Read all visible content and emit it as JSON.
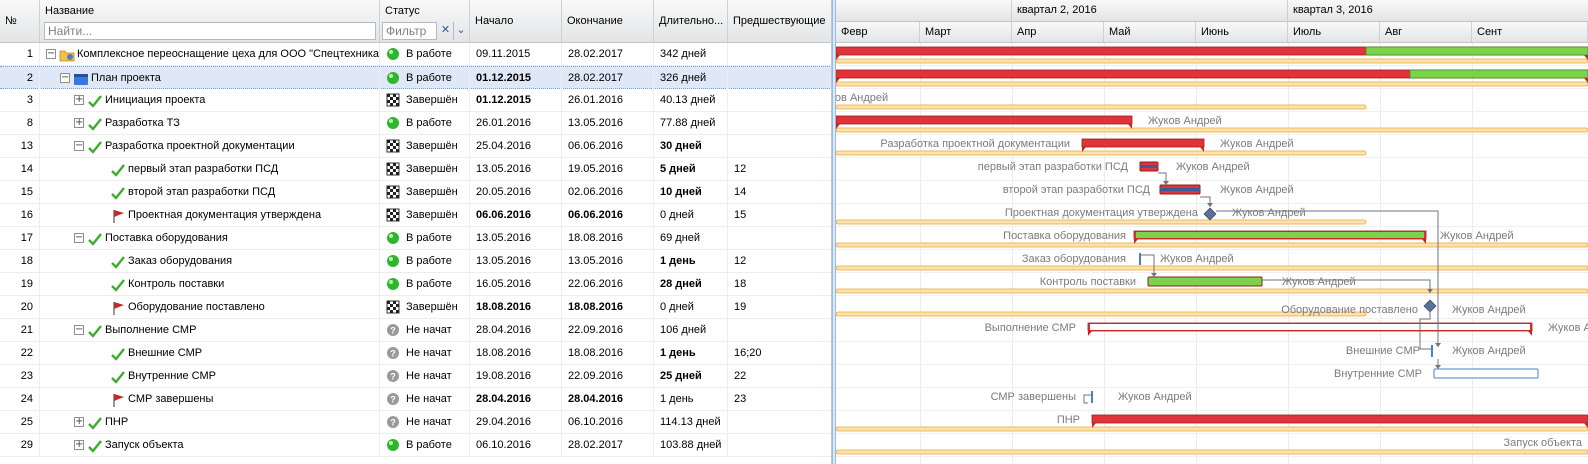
{
  "columns": {
    "num": "№",
    "name": "Название",
    "status": "Статус",
    "start": "Начало",
    "end": "Окончание",
    "duration": "Длительно...",
    "pred": "Предшествующие"
  },
  "filter": {
    "name_placeholder": "Найти...",
    "status_placeholder": "Фильтр"
  },
  "rows": [
    {
      "num": "1",
      "name": "Комплексное переоснащение цеха для ООО \"Спецтехника\"",
      "status": "В работе",
      "start": "09.11.2015",
      "end": "28.02.2017",
      "duration": "342 дней",
      "pred": ""
    },
    {
      "num": "2",
      "name": "План проекта",
      "status": "В работе",
      "start": "01.12.2015",
      "end": "28.02.2017",
      "duration": "326 дней",
      "pred": ""
    },
    {
      "num": "3",
      "name": "Инициация проекта",
      "status": "Завершён",
      "start": "01.12.2015",
      "end": "26.01.2016",
      "duration": "40.13 дней",
      "pred": ""
    },
    {
      "num": "8",
      "name": "Разработка ТЗ",
      "status": "В работе",
      "start": "26.01.2016",
      "end": "13.05.2016",
      "duration": "77.88 дней",
      "pred": ""
    },
    {
      "num": "13",
      "name": "Разработка проектной документации",
      "status": "Завершён",
      "start": "25.04.2016",
      "end": "06.06.2016",
      "duration": "30 дней",
      "pred": ""
    },
    {
      "num": "14",
      "name": "первый этап разработки ПСД",
      "status": "Завершён",
      "start": "13.05.2016",
      "end": "19.05.2016",
      "duration": "5 дней",
      "pred": "12"
    },
    {
      "num": "15",
      "name": "второй этап разработки ПСД",
      "status": "Завершён",
      "start": "20.05.2016",
      "end": "02.06.2016",
      "duration": "10 дней",
      "pred": "14"
    },
    {
      "num": "16",
      "name": "Проектная документация утверждена",
      "status": "Завершён",
      "start": "06.06.2016",
      "end": "06.06.2016",
      "duration": "0 дней",
      "pred": "15"
    },
    {
      "num": "17",
      "name": "Поставка оборудования",
      "status": "В работе",
      "start": "13.05.2016",
      "end": "18.08.2016",
      "duration": "69 дней",
      "pred": ""
    },
    {
      "num": "18",
      "name": "Заказ оборудования",
      "status": "В работе",
      "start": "13.05.2016",
      "end": "13.05.2016",
      "duration": "1 день",
      "pred": "12"
    },
    {
      "num": "19",
      "name": "Контроль поставки",
      "status": "В работе",
      "start": "16.05.2016",
      "end": "22.06.2016",
      "duration": "28 дней",
      "pred": "18"
    },
    {
      "num": "20",
      "name": "Оборудование поставлено",
      "status": "Завершён",
      "start": "18.08.2016",
      "end": "18.08.2016",
      "duration": "0 дней",
      "pred": "19"
    },
    {
      "num": "21",
      "name": "Выполнение СМР",
      "status": "Не начат",
      "start": "28.04.2016",
      "end": "22.09.2016",
      "duration": "106 дней",
      "pred": ""
    },
    {
      "num": "22",
      "name": "Внешние СМР",
      "status": "Не начат",
      "start": "18.08.2016",
      "end": "18.08.2016",
      "duration": "1 день",
      "pred": "16;20"
    },
    {
      "num": "23",
      "name": "Внутренние СМР",
      "status": "Не начат",
      "start": "19.08.2016",
      "end": "22.09.2016",
      "duration": "25 дней",
      "pred": "22"
    },
    {
      "num": "24",
      "name": "СМР завершены",
      "status": "Не начат",
      "start": "28.04.2016",
      "end": "28.04.2016",
      "duration": "1 день",
      "pred": "23"
    },
    {
      "num": "25",
      "name": "ПНР",
      "status": "Не начат",
      "start": "29.04.2016",
      "end": "06.10.2016",
      "duration": "114.13 дней",
      "pred": ""
    },
    {
      "num": "29",
      "name": "Запуск объекта",
      "status": "В работе",
      "start": "06.10.2016",
      "end": "28.02.2017",
      "duration": "103.88 дней",
      "pred": ""
    }
  ],
  "timeline": {
    "quarters": [
      "квартал 2, 2016",
      "квартал 3, 2016"
    ],
    "months": [
      "Февр",
      "Март",
      "Апр",
      "Май",
      "Июнь",
      "Июль",
      "Авг",
      "Сент"
    ]
  },
  "gantt": {
    "resource_labels": [
      "ков Андрей",
      "Жуков Андрей",
      "Жуков Андрей",
      "Жуков Андрей",
      "Жуков Андрей",
      "Жуков Андрей",
      "Жуков Андрей",
      "Жуков Андрей",
      "Жуков Андрей",
      "Жуков Андрей",
      "Жуков Андрей",
      "Жуков Андрей",
      "Жуков Андрей"
    ],
    "task_labels": [
      "Разработка проектной документации",
      "первый этап разработки ПСД",
      "второй этап разработки ПСД",
      "Проектная документация утверждена",
      "Поставка оборудования",
      "Заказ оборудования",
      "Контроль поставки",
      "Оборудование поставлено",
      "Выполнение СМР",
      "Внешние СМР",
      "Внутренние СМР",
      "СМР завершены",
      "ПНР",
      "Запуск объекта"
    ]
  },
  "colors": {
    "accent": "#99bbe8",
    "bar_red": "#e0343a",
    "bar_green": "#7ad34a",
    "bar_yellow": "#f5c86b",
    "status_ok": "#2fb52f",
    "status_pending": "#8e8e8e"
  }
}
